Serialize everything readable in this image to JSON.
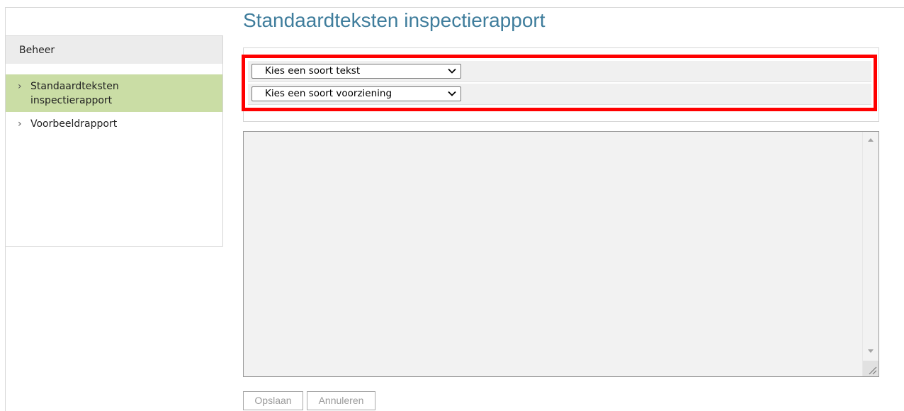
{
  "page": {
    "title": "Standaardteksten inspectierapport"
  },
  "sidebar": {
    "header": "Beheer",
    "items": [
      {
        "label": "Standaardteksten inspectierapport",
        "active": true
      },
      {
        "label": "Voorbeeldrapport",
        "active": false
      }
    ]
  },
  "filters": {
    "text_type": {
      "selected": "Kies een soort tekst"
    },
    "facility_type": {
      "selected": "Kies een soort voorziening"
    }
  },
  "editor": {
    "value": ""
  },
  "actions": {
    "save_label": "Opslaan",
    "cancel_label": "Annuleren"
  },
  "colors": {
    "title": "#3f7d9c",
    "active_item_bg": "#cadda5",
    "highlight": "#ff0000"
  }
}
